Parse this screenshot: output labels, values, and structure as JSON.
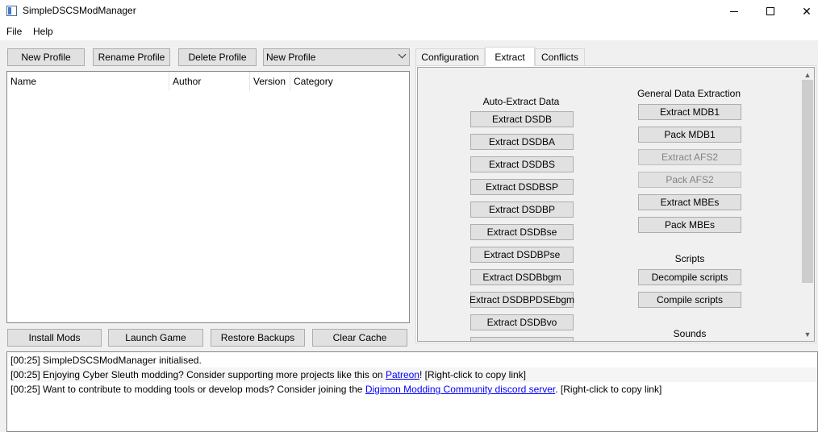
{
  "window": {
    "title": "SimpleDSCSModManager"
  },
  "menu": {
    "file": "File",
    "help": "Help"
  },
  "profile": {
    "new_button": "New Profile",
    "rename_button": "Rename Profile",
    "delete_button": "Delete Profile",
    "selected_profile": "New Profile"
  },
  "mod_table": {
    "columns": [
      "Name",
      "Author",
      "Version",
      "Category"
    ]
  },
  "actions": {
    "install": "Install Mods",
    "launch": "Launch Game",
    "restore": "Restore Backups",
    "clear_cache": "Clear Cache"
  },
  "tabs": [
    "Configuration",
    "Extract",
    "Conflicts"
  ],
  "extract": {
    "auto_title": "Auto-Extract Data",
    "auto_buttons": [
      "Extract DSDB",
      "Extract DSDBA",
      "Extract DSDBS",
      "Extract DSDBSP",
      "Extract DSDBP",
      "Extract DSDBse",
      "Extract DSDBPse",
      "Extract DSDBbgm",
      "Extract DSDBPDSEbgm",
      "Extract DSDBvo"
    ],
    "general_title": "General Data Extraction",
    "general_buttons": [
      "Extract MDB1",
      "Pack MDB1",
      "Extract AFS2",
      "Pack AFS2",
      "Extract MBEs",
      "Pack MBEs"
    ],
    "scripts_title": "Scripts",
    "script_buttons": [
      "Decompile scripts",
      "Compile scripts"
    ],
    "sounds_title": "Sounds"
  },
  "log": {
    "line1": "[00:25] SimpleDSCSModManager initialised.",
    "line2_pre": "[00:25] Enjoying Cyber Sleuth modding? Consider supporting more projects like this on ",
    "line2_link": "Patreon",
    "line2_post": "! [Right-click to copy link]",
    "line3_pre": "[00:25] Want to contribute to modding tools or develop mods? Consider joining the ",
    "line3_link": "Digimon Modding Community discord server",
    "line3_post": ". [Right-click to copy link]"
  }
}
